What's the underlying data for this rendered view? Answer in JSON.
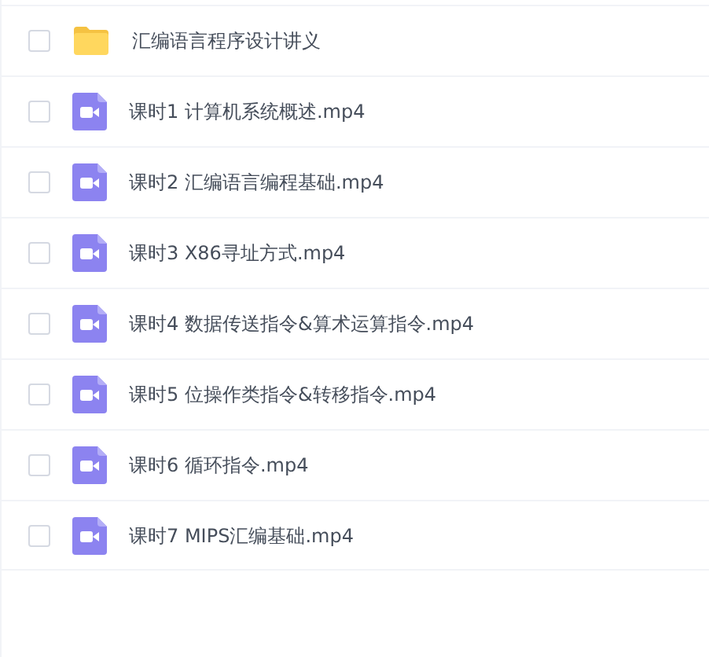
{
  "files": [
    {
      "kind": "folder",
      "name": "汇编语言程序设计讲义",
      "checked": false
    },
    {
      "kind": "video",
      "name": "课时1 计算机系统概述.mp4",
      "checked": false
    },
    {
      "kind": "video",
      "name": "课时2 汇编语言编程基础.mp4",
      "checked": false
    },
    {
      "kind": "video",
      "name": "课时3 X86寻址方式.mp4",
      "checked": false
    },
    {
      "kind": "video",
      "name": "课时4 数据传送指令&算术运算指令.mp4",
      "checked": false
    },
    {
      "kind": "video",
      "name": "课时5 位操作类指令&转移指令.mp4",
      "checked": false
    },
    {
      "kind": "video",
      "name": "课时6 循环指令.mp4",
      "checked": false
    },
    {
      "kind": "video",
      "name": "课时7 MIPS汇编基础.mp4",
      "checked": false
    }
  ]
}
